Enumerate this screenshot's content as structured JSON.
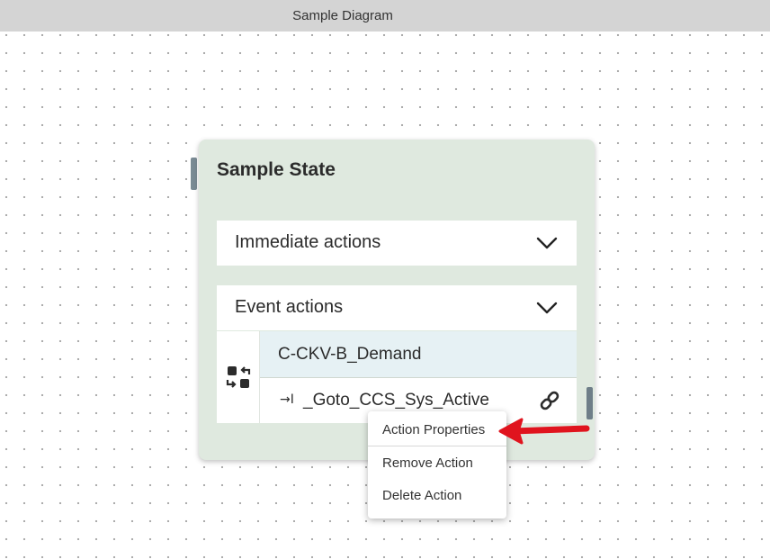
{
  "window": {
    "title": "Sample Diagram"
  },
  "state": {
    "title": "Sample State",
    "sections": {
      "immediate": "Immediate actions",
      "event": "Event actions"
    },
    "event_name": "C-CKV-B_Demand",
    "action": {
      "goto_glyph": "→I",
      "label": "_Goto_CCS_Sys_Active"
    }
  },
  "context_menu": {
    "items": [
      "Action Properties",
      "Remove Action",
      "Delete Action"
    ]
  },
  "colors": {
    "card_background": "#dfe9df",
    "event_highlight": "#e6f1f4",
    "annotation_arrow": "#e0141e"
  },
  "icons": {
    "expand_immediate": "chevron-down-icon",
    "expand_event": "chevron-down-icon",
    "event_type": "swap-icon",
    "action_link": "link-icon",
    "annotation": "arrow-pointer-icon"
  }
}
